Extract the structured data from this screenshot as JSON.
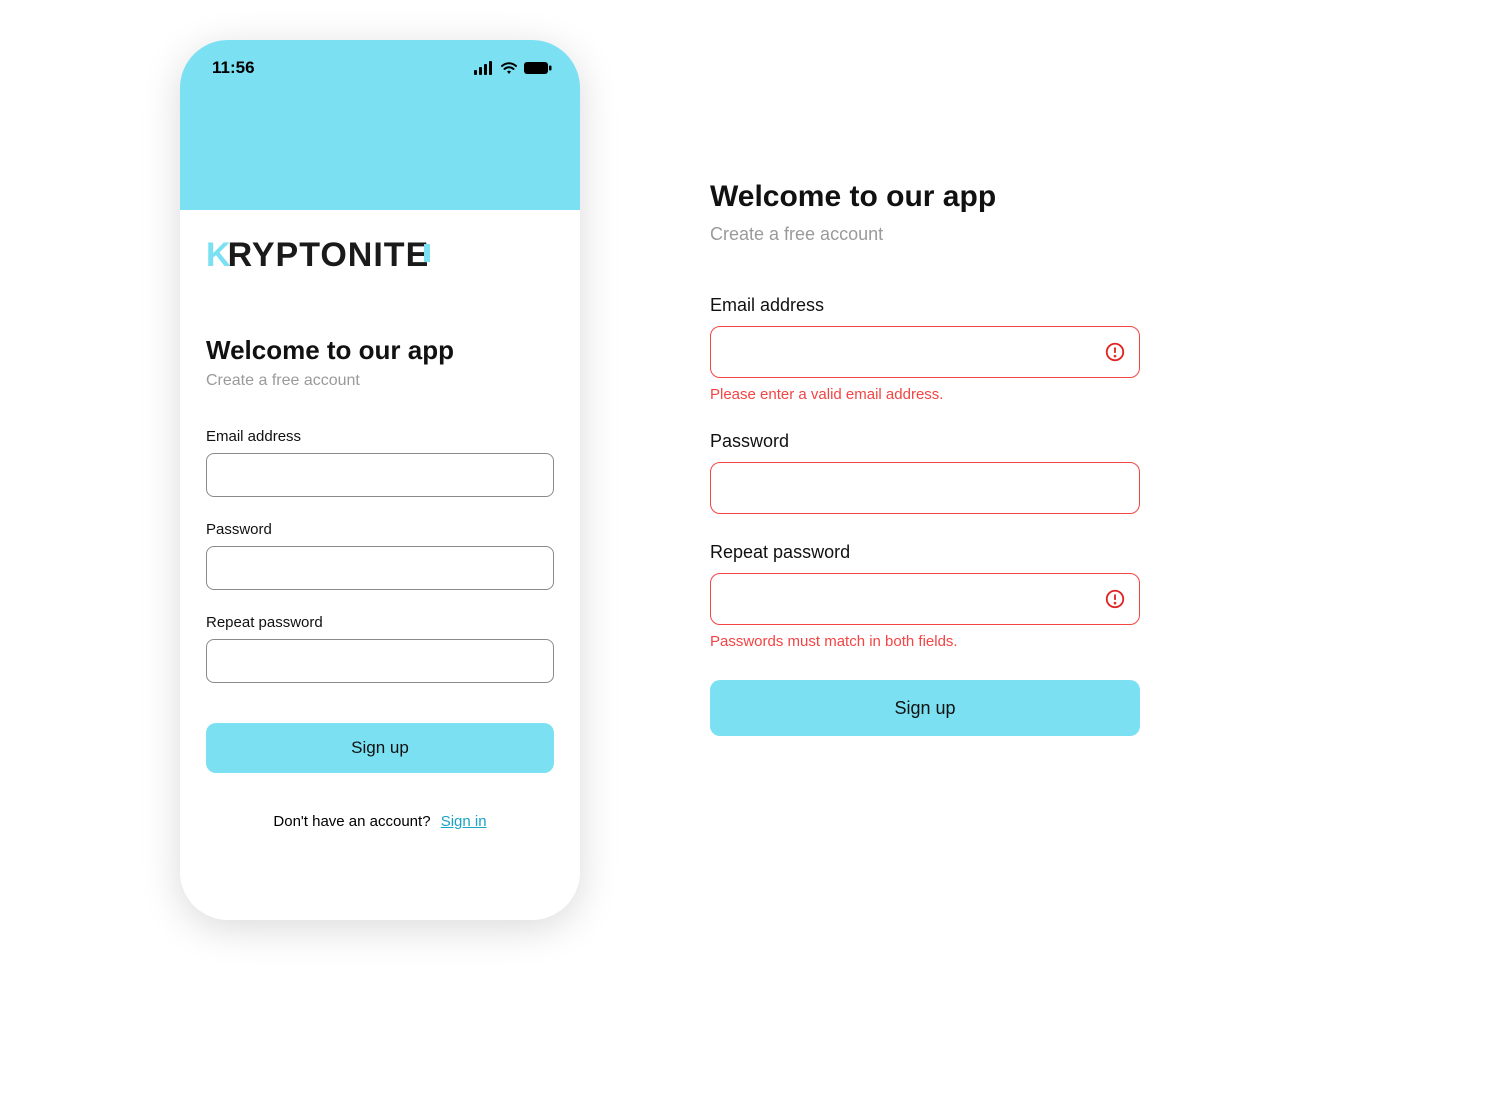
{
  "status_bar": {
    "time": "11:56",
    "icons": [
      "cellular-icon",
      "wifi-icon",
      "battery-icon"
    ]
  },
  "brand": {
    "name": "KRYPTONITE"
  },
  "colors": {
    "accent": "#7AE0F2",
    "error": "#f44444",
    "text_muted": "#9a9a9a"
  },
  "left": {
    "title": "Welcome to our app",
    "subtitle": "Create a free account",
    "fields": {
      "email": {
        "label": "Email address",
        "value": ""
      },
      "password": {
        "label": "Password",
        "value": ""
      },
      "repeat": {
        "label": "Repeat password",
        "value": ""
      }
    },
    "submit_label": "Sign up",
    "footer": {
      "text": "Don't have an account?",
      "link_label": "Sign in"
    }
  },
  "right": {
    "title": "Welcome to our app",
    "subtitle": "Create a free account",
    "fields": {
      "email": {
        "label": "Email address",
        "value": "",
        "has_icon": true,
        "icon": "alert-circle-icon",
        "error": "Please enter a valid email address."
      },
      "password": {
        "label": "Password",
        "value": "",
        "has_icon": false
      },
      "repeat": {
        "label": "Repeat password",
        "value": "",
        "has_icon": true,
        "icon": "alert-circle-icon",
        "error": "Passwords must match in both fields."
      }
    },
    "submit_label": "Sign up"
  }
}
